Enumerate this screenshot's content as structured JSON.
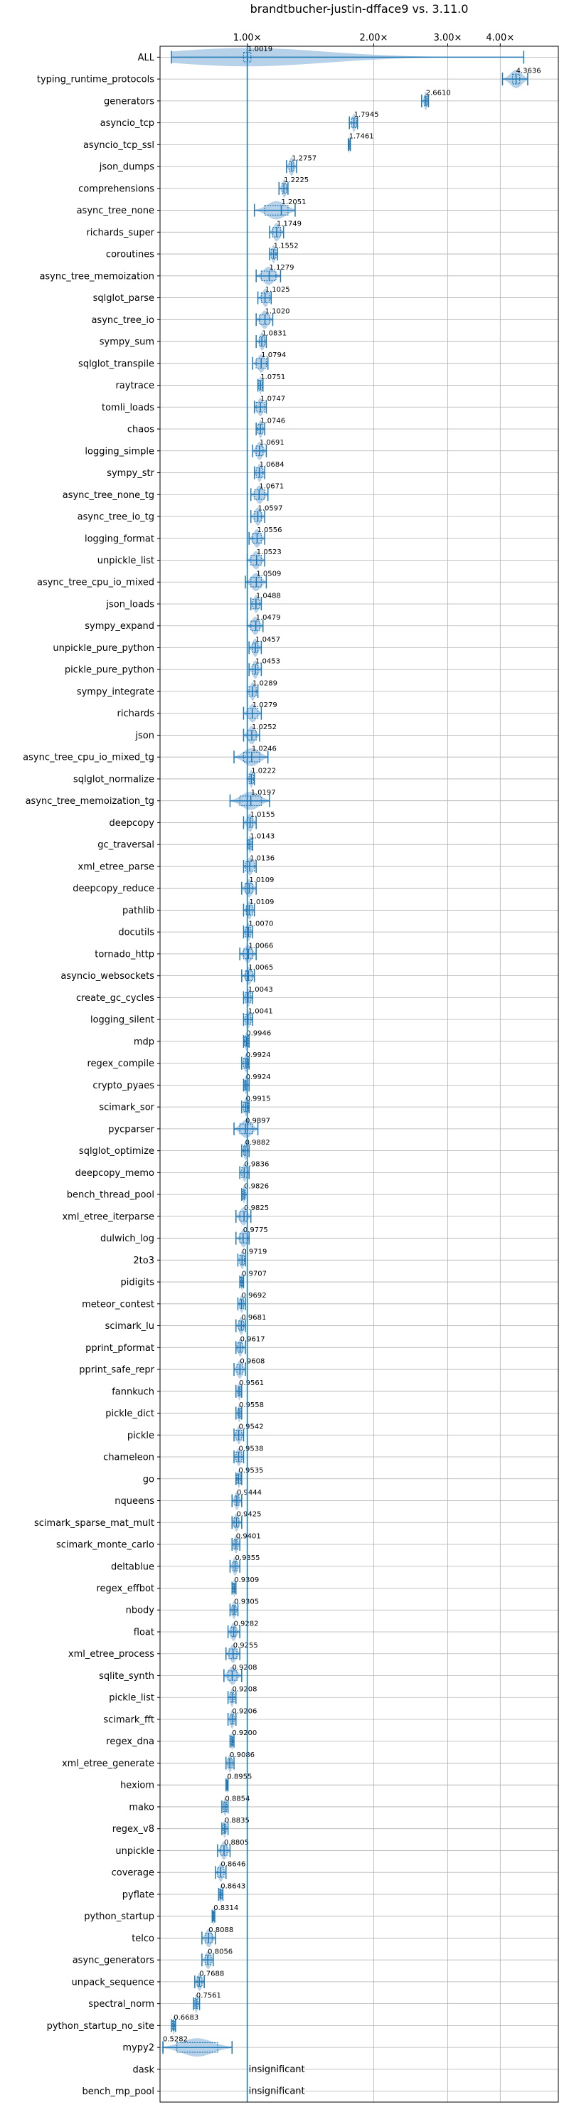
{
  "chart_data": {
    "type": "violin",
    "title": "brandtbucher-justin-dfface9 vs. 3.11.0",
    "xlabel": "",
    "ylabel": "",
    "xscale": "log",
    "xlim": [
      0.62,
      5.5
    ],
    "xticks": [
      {
        "value": 1.0,
        "label": "1.00×"
      },
      {
        "value": 2.0,
        "label": "2.00×"
      },
      {
        "value": 3.0,
        "label": "3.00×"
      },
      {
        "value": 4.0,
        "label": "4.00×"
      }
    ],
    "reference_line": 1.0,
    "grid": true,
    "colors": {
      "violin": "#a9c9e4",
      "box": "#1f77b4",
      "refline": "#1f77b4",
      "grid": "#b0b0b0"
    },
    "insignificant_label": "insignificant",
    "benchmarks": [
      {
        "name": "ALL",
        "value": 1.0019,
        "label": "1.0019",
        "lo": 0.66,
        "hi": 4.55,
        "box": [
          0.98,
          1.02
        ]
      },
      {
        "name": "typing_runtime_protocols",
        "value": 4.3636,
        "label": "4.3636",
        "lo": 4.05,
        "hi": 4.65,
        "box": [
          4.28,
          4.45
        ]
      },
      {
        "name": "generators",
        "value": 2.661,
        "label": "2.6610",
        "lo": 2.6,
        "hi": 2.7,
        "box": [
          2.64,
          2.68
        ]
      },
      {
        "name": "asyncio_tcp",
        "value": 1.7945,
        "label": "1.7945",
        "lo": 1.75,
        "hi": 1.83,
        "box": [
          1.77,
          1.82
        ]
      },
      {
        "name": "asyncio_tcp_ssl",
        "value": 1.7461,
        "label": "1.7461",
        "lo": 1.74,
        "hi": 1.76,
        "box": [
          1.74,
          1.755
        ]
      },
      {
        "name": "json_dumps",
        "value": 1.2757,
        "label": "1.2757",
        "lo": 1.24,
        "hi": 1.31,
        "box": [
          1.26,
          1.29
        ]
      },
      {
        "name": "comprehensions",
        "value": 1.2225,
        "label": "1.2225",
        "lo": 1.19,
        "hi": 1.25,
        "box": [
          1.21,
          1.24
        ]
      },
      {
        "name": "async_tree_none",
        "value": 1.2051,
        "label": "1.2051",
        "lo": 1.04,
        "hi": 1.3,
        "box": [
          1.1,
          1.25
        ]
      },
      {
        "name": "richards_super",
        "value": 1.1749,
        "label": "1.1749",
        "lo": 1.13,
        "hi": 1.22,
        "box": [
          1.15,
          1.2
        ]
      },
      {
        "name": "coroutines",
        "value": 1.1552,
        "label": "1.1552",
        "lo": 1.13,
        "hi": 1.18,
        "box": [
          1.14,
          1.17
        ]
      },
      {
        "name": "async_tree_memoization",
        "value": 1.1279,
        "label": "1.1279",
        "lo": 1.05,
        "hi": 1.2,
        "box": [
          1.08,
          1.17
        ]
      },
      {
        "name": "sqlglot_parse",
        "value": 1.1025,
        "label": "1.1025",
        "lo": 1.06,
        "hi": 1.14,
        "box": [
          1.08,
          1.13
        ]
      },
      {
        "name": "async_tree_io",
        "value": 1.102,
        "label": "1.1020",
        "lo": 1.05,
        "hi": 1.15,
        "box": [
          1.07,
          1.13
        ]
      },
      {
        "name": "sympy_sum",
        "value": 1.0831,
        "label": "1.0831",
        "lo": 1.05,
        "hi": 1.11,
        "box": [
          1.07,
          1.1
        ]
      },
      {
        "name": "sqlglot_transpile",
        "value": 1.0794,
        "label": "1.0794",
        "lo": 1.03,
        "hi": 1.12,
        "box": [
          1.05,
          1.11
        ]
      },
      {
        "name": "raytrace",
        "value": 1.0751,
        "label": "1.0751",
        "lo": 1.06,
        "hi": 1.09,
        "box": [
          1.065,
          1.085
        ]
      },
      {
        "name": "tomli_loads",
        "value": 1.0747,
        "label": "1.0747",
        "lo": 1.04,
        "hi": 1.11,
        "box": [
          1.05,
          1.1
        ]
      },
      {
        "name": "chaos",
        "value": 1.0746,
        "label": "1.0746",
        "lo": 1.05,
        "hi": 1.1,
        "box": [
          1.06,
          1.09
        ]
      },
      {
        "name": "logging_simple",
        "value": 1.0691,
        "label": "1.0691",
        "lo": 1.03,
        "hi": 1.11,
        "box": [
          1.05,
          1.09
        ]
      },
      {
        "name": "sympy_str",
        "value": 1.0684,
        "label": "1.0684",
        "lo": 1.04,
        "hi": 1.1,
        "box": [
          1.05,
          1.09
        ]
      },
      {
        "name": "async_tree_none_tg",
        "value": 1.0671,
        "label": "1.0671",
        "lo": 1.02,
        "hi": 1.12,
        "box": [
          1.04,
          1.1
        ]
      },
      {
        "name": "async_tree_io_tg",
        "value": 1.0597,
        "label": "1.0597",
        "lo": 1.02,
        "hi": 1.1,
        "box": [
          1.04,
          1.08
        ]
      },
      {
        "name": "logging_format",
        "value": 1.0556,
        "label": "1.0556",
        "lo": 1.01,
        "hi": 1.1,
        "box": [
          1.03,
          1.08
        ]
      },
      {
        "name": "unpickle_list",
        "value": 1.0523,
        "label": "1.0523",
        "lo": 1.0,
        "hi": 1.1,
        "box": [
          1.02,
          1.08
        ]
      },
      {
        "name": "async_tree_cpu_io_mixed",
        "value": 1.0509,
        "label": "1.0509",
        "lo": 0.99,
        "hi": 1.11,
        "box": [
          1.02,
          1.08
        ]
      },
      {
        "name": "json_loads",
        "value": 1.0488,
        "label": "1.0488",
        "lo": 1.02,
        "hi": 1.08,
        "box": [
          1.03,
          1.07
        ]
      },
      {
        "name": "sympy_expand",
        "value": 1.0479,
        "label": "1.0479",
        "lo": 1.0,
        "hi": 1.09,
        "box": [
          1.02,
          1.07
        ]
      },
      {
        "name": "unpickle_pure_python",
        "value": 1.0457,
        "label": "1.0457",
        "lo": 1.01,
        "hi": 1.08,
        "box": [
          1.03,
          1.06
        ]
      },
      {
        "name": "pickle_pure_python",
        "value": 1.0453,
        "label": "1.0453",
        "lo": 1.01,
        "hi": 1.08,
        "box": [
          1.03,
          1.06
        ]
      },
      {
        "name": "sympy_integrate",
        "value": 1.0289,
        "label": "1.0289",
        "lo": 1.0,
        "hi": 1.06,
        "box": [
          1.01,
          1.05
        ]
      },
      {
        "name": "richards",
        "value": 1.0279,
        "label": "1.0279",
        "lo": 0.98,
        "hi": 1.08,
        "box": [
          1.0,
          1.06
        ]
      },
      {
        "name": "json",
        "value": 1.0252,
        "label": "1.0252",
        "lo": 0.98,
        "hi": 1.07,
        "box": [
          1.0,
          1.05
        ]
      },
      {
        "name": "async_tree_cpu_io_mixed_tg",
        "value": 1.0246,
        "label": "1.0246",
        "lo": 0.93,
        "hi": 1.12,
        "box": [
          0.98,
          1.07
        ]
      },
      {
        "name": "sqlglot_normalize",
        "value": 1.0222,
        "label": "1.0222",
        "lo": 1.0,
        "hi": 1.04,
        "box": [
          1.01,
          1.035
        ]
      },
      {
        "name": "async_tree_memoization_tg",
        "value": 1.0197,
        "label": "1.0197",
        "lo": 0.91,
        "hi": 1.13,
        "box": [
          0.96,
          1.08
        ]
      },
      {
        "name": "deepcopy",
        "value": 1.0155,
        "label": "1.0155",
        "lo": 0.98,
        "hi": 1.05,
        "box": [
          1.0,
          1.03
        ]
      },
      {
        "name": "gc_traversal",
        "value": 1.0143,
        "label": "1.0143",
        "lo": 1.0,
        "hi": 1.03,
        "box": [
          1.005,
          1.025
        ]
      },
      {
        "name": "xml_etree_parse",
        "value": 1.0136,
        "label": "1.0136",
        "lo": 0.98,
        "hi": 1.05,
        "box": [
          0.99,
          1.04
        ]
      },
      {
        "name": "deepcopy_reduce",
        "value": 1.0109,
        "label": "1.0109",
        "lo": 0.97,
        "hi": 1.05,
        "box": [
          0.99,
          1.03
        ]
      },
      {
        "name": "pathlib",
        "value": 1.0109,
        "label": "1.0109",
        "lo": 0.98,
        "hi": 1.04,
        "box": [
          0.995,
          1.03
        ]
      },
      {
        "name": "docutils",
        "value": 1.007,
        "label": "1.0070",
        "lo": 0.98,
        "hi": 1.03,
        "box": [
          0.99,
          1.02
        ]
      },
      {
        "name": "tornado_http",
        "value": 1.0066,
        "label": "1.0066",
        "lo": 0.96,
        "hi": 1.05,
        "box": [
          0.98,
          1.03
        ]
      },
      {
        "name": "asyncio_websockets",
        "value": 1.0065,
        "label": "1.0065",
        "lo": 0.97,
        "hi": 1.04,
        "box": [
          0.99,
          1.03
        ]
      },
      {
        "name": "create_gc_cycles",
        "value": 1.0043,
        "label": "1.0043",
        "lo": 0.98,
        "hi": 1.03,
        "box": [
          0.99,
          1.02
        ]
      },
      {
        "name": "logging_silent",
        "value": 1.0041,
        "label": "1.0041",
        "lo": 0.98,
        "hi": 1.03,
        "box": [
          0.99,
          1.02
        ]
      },
      {
        "name": "mdp",
        "value": 0.9946,
        "label": "0.9946",
        "lo": 0.98,
        "hi": 1.01,
        "box": [
          0.985,
          1.005
        ]
      },
      {
        "name": "regex_compile",
        "value": 0.9924,
        "label": "0.9924",
        "lo": 0.97,
        "hi": 1.01,
        "box": [
          0.98,
          1.005
        ]
      },
      {
        "name": "crypto_pyaes",
        "value": 0.9924,
        "label": "0.9924",
        "lo": 0.98,
        "hi": 1.01,
        "box": [
          0.985,
          1.0
        ]
      },
      {
        "name": "scimark_sor",
        "value": 0.9915,
        "label": "0.9915",
        "lo": 0.97,
        "hi": 1.01,
        "box": [
          0.98,
          1.005
        ]
      },
      {
        "name": "pycparser",
        "value": 0.9897,
        "label": "0.9897",
        "lo": 0.93,
        "hi": 1.06,
        "box": [
          0.96,
          1.03
        ]
      },
      {
        "name": "sqlglot_optimize",
        "value": 0.9882,
        "label": "0.9882",
        "lo": 0.97,
        "hi": 1.01,
        "box": [
          0.98,
          1.0
        ]
      },
      {
        "name": "deepcopy_memo",
        "value": 0.9836,
        "label": "0.9836",
        "lo": 0.96,
        "hi": 1.01,
        "box": [
          0.97,
          1.0
        ]
      },
      {
        "name": "bench_thread_pool",
        "value": 0.9826,
        "label": "0.9826",
        "lo": 0.97,
        "hi": 1.0,
        "box": [
          0.975,
          0.99
        ]
      },
      {
        "name": "xml_etree_iterparse",
        "value": 0.9825,
        "label": "0.9825",
        "lo": 0.94,
        "hi": 1.02,
        "box": [
          0.96,
          1.0
        ]
      },
      {
        "name": "dulwich_log",
        "value": 0.9775,
        "label": "0.9775",
        "lo": 0.94,
        "hi": 1.01,
        "box": [
          0.96,
          1.0
        ]
      },
      {
        "name": "2to3",
        "value": 0.9719,
        "label": "0.9719",
        "lo": 0.95,
        "hi": 0.99,
        "box": [
          0.96,
          0.985
        ]
      },
      {
        "name": "pidigits",
        "value": 0.9707,
        "label": "0.9707",
        "lo": 0.96,
        "hi": 0.98,
        "box": [
          0.965,
          0.977
        ]
      },
      {
        "name": "meteor_contest",
        "value": 0.9692,
        "label": "0.9692",
        "lo": 0.95,
        "hi": 0.99,
        "box": [
          0.96,
          0.98
        ]
      },
      {
        "name": "scimark_lu",
        "value": 0.9681,
        "label": "0.9681",
        "lo": 0.94,
        "hi": 0.99,
        "box": [
          0.955,
          0.98
        ]
      },
      {
        "name": "pprint_pformat",
        "value": 0.9617,
        "label": "0.9617",
        "lo": 0.94,
        "hi": 0.99,
        "box": [
          0.95,
          0.975
        ]
      },
      {
        "name": "pprint_safe_repr",
        "value": 0.9608,
        "label": "0.9608",
        "lo": 0.93,
        "hi": 0.99,
        "box": [
          0.945,
          0.975
        ]
      },
      {
        "name": "fannkuch",
        "value": 0.9561,
        "label": "0.9561",
        "lo": 0.94,
        "hi": 0.97,
        "box": [
          0.95,
          0.965
        ]
      },
      {
        "name": "pickle_dict",
        "value": 0.9558,
        "label": "0.9558",
        "lo": 0.94,
        "hi": 0.97,
        "box": [
          0.95,
          0.965
        ]
      },
      {
        "name": "pickle",
        "value": 0.9542,
        "label": "0.9542",
        "lo": 0.93,
        "hi": 0.98,
        "box": [
          0.94,
          0.97
        ]
      },
      {
        "name": "chameleon",
        "value": 0.9538,
        "label": "0.9538",
        "lo": 0.93,
        "hi": 0.98,
        "box": [
          0.94,
          0.97
        ]
      },
      {
        "name": "go",
        "value": 0.9535,
        "label": "0.9535",
        "lo": 0.94,
        "hi": 0.97,
        "box": [
          0.945,
          0.965
        ]
      },
      {
        "name": "nqueens",
        "value": 0.9444,
        "label": "0.9444",
        "lo": 0.92,
        "hi": 0.97,
        "box": [
          0.935,
          0.955
        ]
      },
      {
        "name": "scimark_sparse_mat_mult",
        "value": 0.9425,
        "label": "0.9425",
        "lo": 0.92,
        "hi": 0.97,
        "box": [
          0.93,
          0.955
        ]
      },
      {
        "name": "scimark_monte_carlo",
        "value": 0.9401,
        "label": "0.9401",
        "lo": 0.92,
        "hi": 0.96,
        "box": [
          0.93,
          0.95
        ]
      },
      {
        "name": "deltablue",
        "value": 0.9355,
        "label": "0.9355",
        "lo": 0.91,
        "hi": 0.96,
        "box": [
          0.925,
          0.945
        ]
      },
      {
        "name": "regex_effbot",
        "value": 0.9309,
        "label": "0.9309",
        "lo": 0.92,
        "hi": 0.94,
        "box": [
          0.925,
          0.937
        ]
      },
      {
        "name": "nbody",
        "value": 0.9305,
        "label": "0.9305",
        "lo": 0.91,
        "hi": 0.95,
        "box": [
          0.92,
          0.94
        ]
      },
      {
        "name": "float",
        "value": 0.9282,
        "label": "0.9282",
        "lo": 0.9,
        "hi": 0.96,
        "box": [
          0.915,
          0.94
        ]
      },
      {
        "name": "xml_etree_process",
        "value": 0.9255,
        "label": "0.9255",
        "lo": 0.89,
        "hi": 0.96,
        "box": [
          0.905,
          0.945
        ]
      },
      {
        "name": "sqlite_synth",
        "value": 0.9208,
        "label": "0.9208",
        "lo": 0.88,
        "hi": 0.97,
        "box": [
          0.9,
          0.945
        ]
      },
      {
        "name": "pickle_list",
        "value": 0.9208,
        "label": "0.9208",
        "lo": 0.9,
        "hi": 0.94,
        "box": [
          0.91,
          0.93
        ]
      },
      {
        "name": "scimark_fft",
        "value": 0.9206,
        "label": "0.9206",
        "lo": 0.9,
        "hi": 0.94,
        "box": [
          0.91,
          0.93
        ]
      },
      {
        "name": "regex_dna",
        "value": 0.92,
        "label": "0.9200",
        "lo": 0.91,
        "hi": 0.93,
        "box": [
          0.915,
          0.925
        ]
      },
      {
        "name": "xml_etree_generate",
        "value": 0.9086,
        "label": "0.9086",
        "lo": 0.89,
        "hi": 0.93,
        "box": [
          0.9,
          0.92
        ]
      },
      {
        "name": "hexiom",
        "value": 0.8955,
        "label": "0.8955",
        "lo": 0.89,
        "hi": 0.9,
        "box": [
          0.892,
          0.899
        ]
      },
      {
        "name": "mako",
        "value": 0.8854,
        "label": "0.8854",
        "lo": 0.87,
        "hi": 0.9,
        "box": [
          0.878,
          0.893
        ]
      },
      {
        "name": "regex_v8",
        "value": 0.8835,
        "label": "0.8835",
        "lo": 0.87,
        "hi": 0.9,
        "box": [
          0.877,
          0.89
        ]
      },
      {
        "name": "unpickle",
        "value": 0.8805,
        "label": "0.8805",
        "lo": 0.85,
        "hi": 0.91,
        "box": [
          0.865,
          0.895
        ]
      },
      {
        "name": "coverage",
        "value": 0.8646,
        "label": "0.8646",
        "lo": 0.84,
        "hi": 0.89,
        "box": [
          0.85,
          0.88
        ]
      },
      {
        "name": "pyflate",
        "value": 0.8643,
        "label": "0.8643",
        "lo": 0.855,
        "hi": 0.875,
        "box": [
          0.86,
          0.87
        ]
      },
      {
        "name": "python_startup",
        "value": 0.8314,
        "label": "0.8314",
        "lo": 0.825,
        "hi": 0.837,
        "box": [
          0.828,
          0.834
        ]
      },
      {
        "name": "telco",
        "value": 0.8088,
        "label": "0.8088",
        "lo": 0.78,
        "hi": 0.84,
        "box": [
          0.795,
          0.825
        ]
      },
      {
        "name": "async_generators",
        "value": 0.8056,
        "label": "0.8056",
        "lo": 0.78,
        "hi": 0.83,
        "box": [
          0.795,
          0.82
        ]
      },
      {
        "name": "unpack_sequence",
        "value": 0.7688,
        "label": "0.7688",
        "lo": 0.75,
        "hi": 0.79,
        "box": [
          0.76,
          0.78
        ]
      },
      {
        "name": "spectral_norm",
        "value": 0.7561,
        "label": "0.7561",
        "lo": 0.745,
        "hi": 0.77,
        "box": [
          0.75,
          0.762
        ]
      },
      {
        "name": "python_startup_no_site",
        "value": 0.6683,
        "label": "0.6683",
        "lo": 0.66,
        "hi": 0.675,
        "box": [
          0.664,
          0.672
        ]
      },
      {
        "name": "mypy2",
        "value": 0.5282,
        "label": "0.5282",
        "lo": 0.63,
        "hi": 0.92,
        "box": [
          0.68,
          0.85
        ]
      },
      {
        "name": "dask",
        "insignificant": true
      },
      {
        "name": "bench_mp_pool",
        "insignificant": true
      }
    ]
  }
}
